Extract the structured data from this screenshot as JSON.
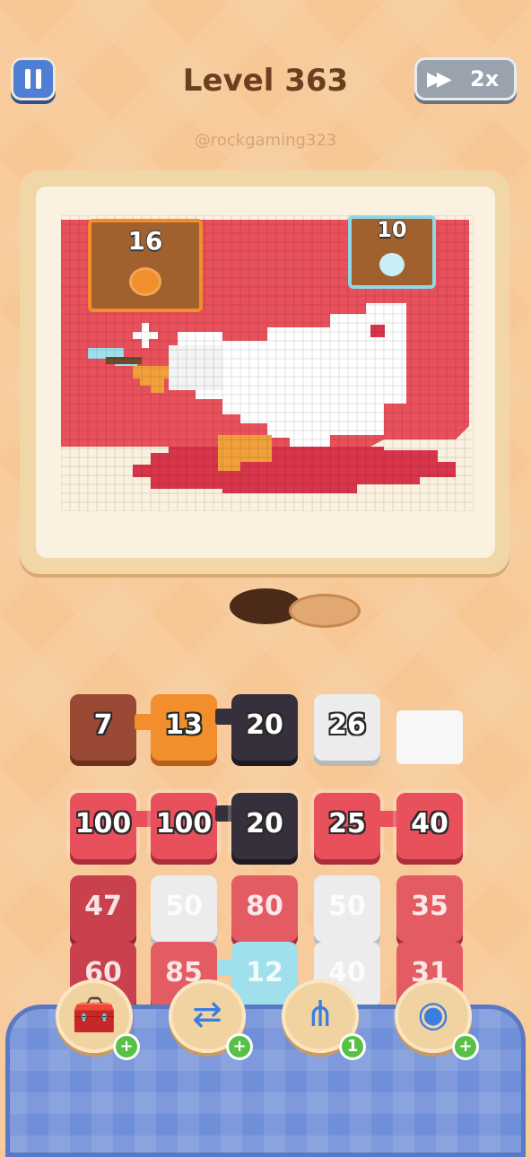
{
  "header": {
    "level_title": "Level 363",
    "speed_label": "2x",
    "watermark": "@rockgaming323",
    "pause_icon": "pause-icon",
    "speed_icon": "fast-forward-icon"
  },
  "board": {
    "counters": [
      {
        "value": "16",
        "color": "#f28e2b"
      },
      {
        "value": "10",
        "color": "#8fd6e6"
      }
    ]
  },
  "queue": [
    {
      "value": "7",
      "color": "#9a4a34"
    },
    {
      "value": "13",
      "color": "#f28e2b"
    },
    {
      "value": "20",
      "color": "#35303c"
    },
    {
      "value": "26",
      "color": "#ececec"
    },
    {
      "value": "",
      "color": "#f7f7f7"
    }
  ],
  "grid": [
    [
      {
        "value": "100",
        "color": "#e8505b"
      },
      {
        "value": "100",
        "color": "#e8505b"
      },
      {
        "value": "20",
        "color": "#35303c"
      },
      {
        "value": "25",
        "color": "#e8505b"
      },
      {
        "value": "40",
        "color": "#e8505b"
      }
    ],
    [
      {
        "value": "47",
        "color": "#c9414c"
      },
      {
        "value": "50",
        "color": "#ececec"
      },
      {
        "value": "80",
        "color": "#e45c63"
      },
      {
        "value": "50",
        "color": "#ececec"
      },
      {
        "value": "35",
        "color": "#e45c63"
      }
    ],
    [
      {
        "value": "60",
        "color": "#c9414c"
      },
      {
        "value": "85",
        "color": "#e45c63"
      },
      {
        "value": "12",
        "color": "#9fe0ec"
      },
      {
        "value": "40",
        "color": "#ececec"
      },
      {
        "value": "31",
        "color": "#e45c63"
      }
    ]
  ],
  "boosters": [
    {
      "icon": "add-slot-icon",
      "badge": "+"
    },
    {
      "icon": "swap-icon",
      "badge": "+"
    },
    {
      "icon": "magnet-claw-icon",
      "badge": "1"
    },
    {
      "icon": "bubble-icon",
      "badge": "+"
    }
  ],
  "colors": {
    "background": "#f7c896",
    "red": "#e8505b",
    "tray": "#6f8fd8"
  }
}
